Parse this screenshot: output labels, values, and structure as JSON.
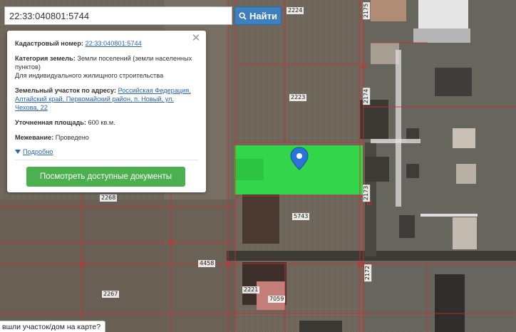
{
  "search": {
    "value": "22:33:040801:5744",
    "button_label": "Найти"
  },
  "popup": {
    "cadastral_label": "Кадастровый номер:",
    "cadastral_value": "22:33:040801:5744",
    "category_label": "Категория земель:",
    "category_value": "Земли поселений (земли населенных пунктов)",
    "usage_value": "Для индивидуального жилищного строительства",
    "address_label": "Земельный участок по адресу:",
    "address_value": "Российская Федерация, Алтайский край, Первомайский район, п. Новый, ул. Чехова, 22",
    "area_label": "Уточненная площадь:",
    "area_value": "600 кв.м.",
    "survey_label": "Межевание:",
    "survey_value": "Проведено",
    "more_link": "Подробно",
    "docs_button": "Посмотреть доступные документы"
  },
  "map": {
    "parcel_labels": {
      "p2224": "2224",
      "p2175": "2175",
      "p2223": "2223",
      "p2174": "2174",
      "p2268": "2268",
      "p2173": "2173",
      "p5743": "5743",
      "p4458": "4458",
      "p2172": "2172",
      "p2267": "2267",
      "p2221": "2221",
      "p7059": "7059"
    },
    "highlight_color": "#2fdc4a",
    "boundary_color": "#d42a2a",
    "marker_color": "#2a73d9"
  },
  "hint": {
    "text": "вшли участок/дом на карте?"
  }
}
